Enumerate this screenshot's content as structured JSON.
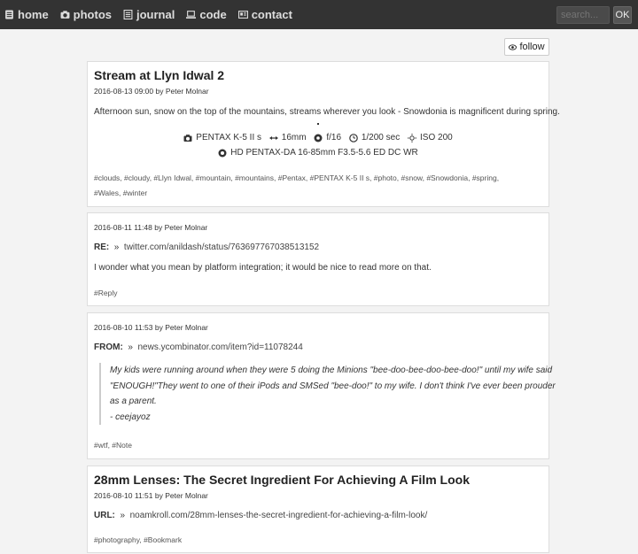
{
  "nav": {
    "items": [
      {
        "label": "home",
        "icon": "book-icon"
      },
      {
        "label": "photos",
        "icon": "camera-icon"
      },
      {
        "label": "journal",
        "icon": "journal-icon"
      },
      {
        "label": "code",
        "icon": "laptop-icon"
      },
      {
        "label": "contact",
        "icon": "contact-icon"
      }
    ],
    "search_placeholder": "search...",
    "ok_label": "OK"
  },
  "follow_label": "follow",
  "posts": [
    {
      "title": "Stream at Llyn Idwal 2",
      "date": "2016-08-13 09:00",
      "author": "Peter Molnar",
      "text": "Afternoon sun, snow on the top of the mountains, streams wherever you look - Snowdonia is magnificent during spring.",
      "exif": {
        "camera": "PENTAX K-5 II s",
        "focal": "16mm",
        "aperture": "f/16",
        "shutter": "1/200 sec",
        "iso": "ISO 200",
        "lens": "HD PENTAX-DA 16-85mm F3.5-5.6 ED DC WR"
      },
      "tags_line1": "#clouds, #cloudy, #Llyn Idwal, #mountain, #mountains, #Pentax, #PENTAX K-5 II s, #photo, #snow, #Snowdonia, #spring,",
      "tags_line2": "#Wales, #winter"
    },
    {
      "date": "2016-08-11 11:48",
      "author": "Peter Molnar",
      "ref_label": "RE:",
      "ref_link": "twitter.com/anildash/status/763697767038513152",
      "text": "I wonder what you mean by platform integration; it would be nice to read more on that.",
      "tags": "#Reply"
    },
    {
      "date": "2016-08-10 11:53",
      "author": "Peter Molnar",
      "ref_label": "FROM:",
      "ref_link": "news.ycombinator.com/item?id=11078244",
      "quote_lines": [
        "My kids were running around when they were 5 doing the Minions \"bee-doo-bee-doo-bee-doo!\" until my wife said",
        "\"ENOUGH!\"They went to one of their iPods and SMSed \"bee-doo!\" to my wife. I don't think I've ever been prouder",
        "as a parent.",
        "- ceejayoz"
      ],
      "tags": "#wtf, #Note"
    },
    {
      "title": "28mm Lenses: The Secret Ingredient For Achieving A Film Look",
      "date": "2016-08-10 11:51",
      "author": "Peter Molnar",
      "ref_label": "URL:",
      "ref_link": "noamkroll.com/28mm-lenses-the-secret-ingredient-for-achieving-a-film-look/",
      "tags": "#photography, #Bookmark"
    }
  ],
  "by_label": "by"
}
